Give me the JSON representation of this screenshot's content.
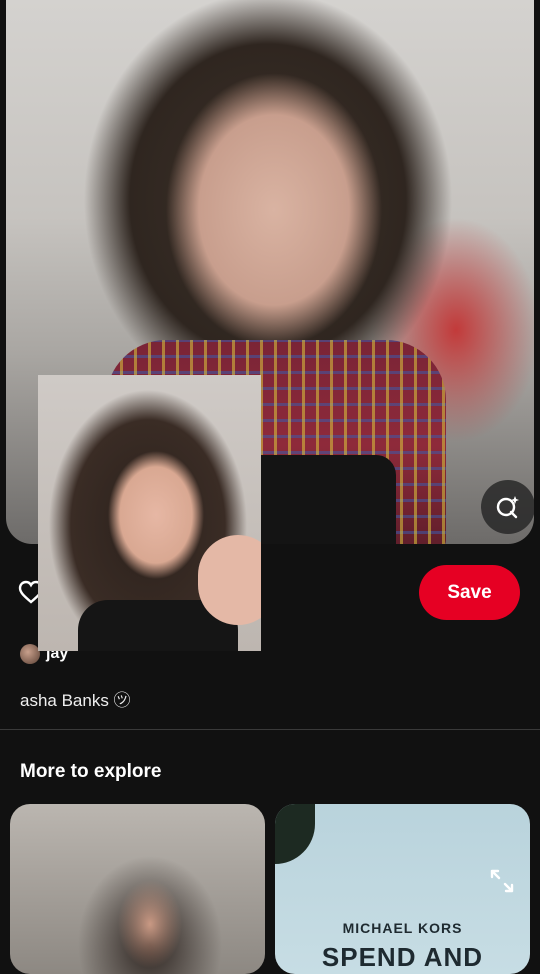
{
  "actions": {
    "save_label": "Save"
  },
  "pin": {
    "creator_name": "jay",
    "description": "asha Banks ㋡"
  },
  "explore": {
    "heading": "More to explore",
    "cards": [
      {
        "kind": "image"
      },
      {
        "brand": "MICHAEL KORS",
        "headline": "SPEND AND"
      }
    ]
  },
  "colors": {
    "accent": "#e60023",
    "background": "#111111"
  }
}
